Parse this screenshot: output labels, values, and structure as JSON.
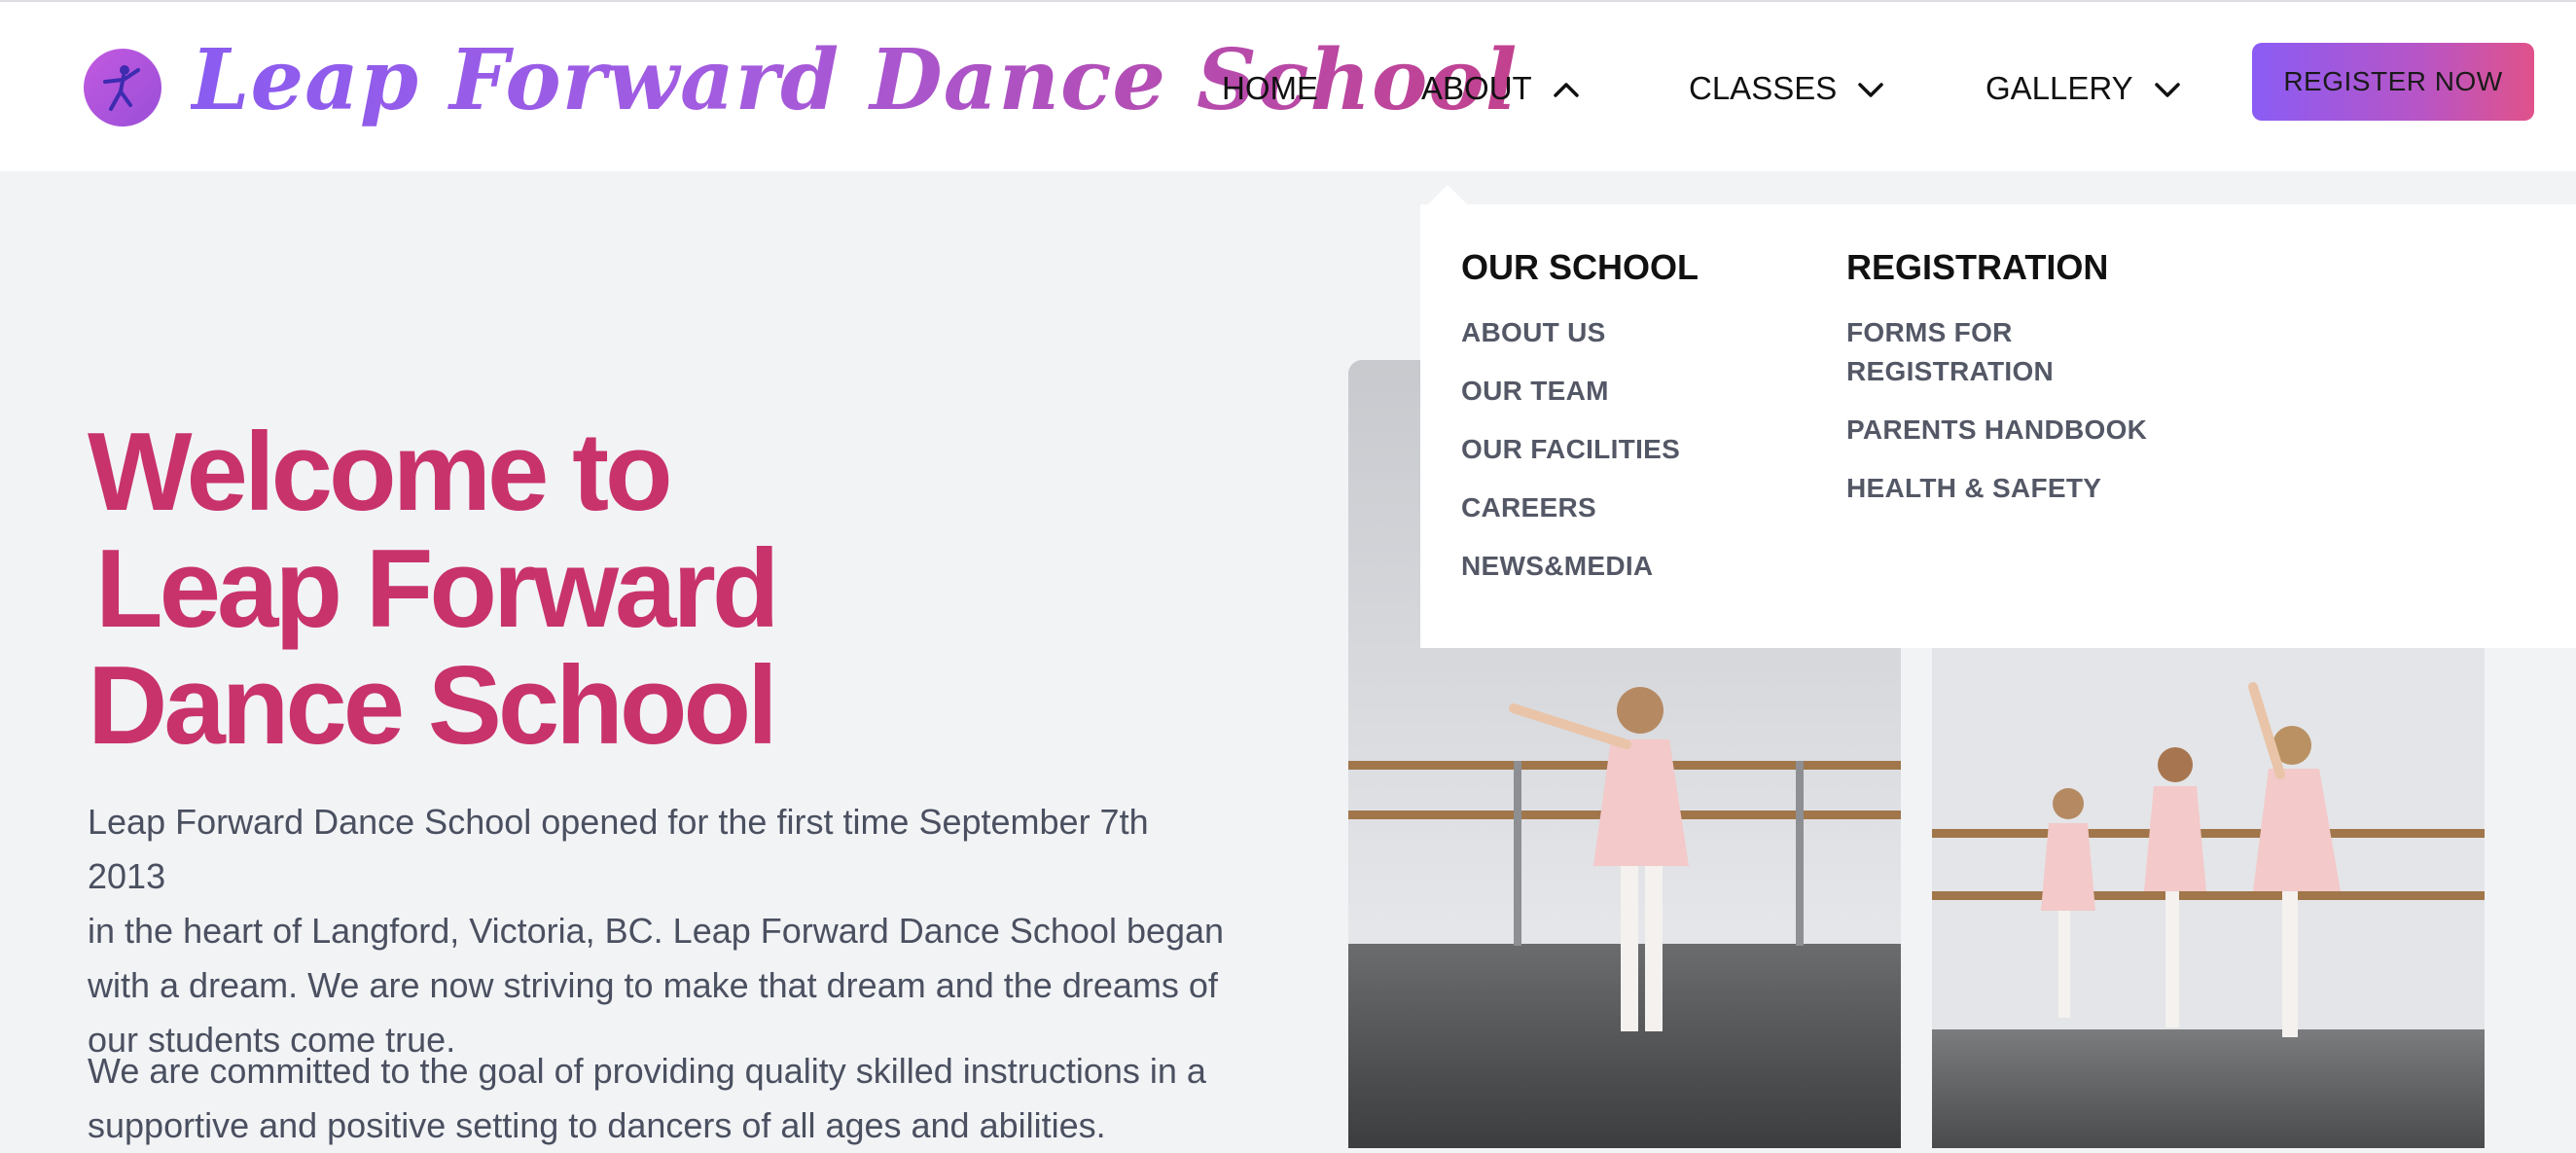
{
  "header": {
    "site_title": "Leap Forward Dance School",
    "nav": [
      {
        "label": "HOME"
      },
      {
        "label": "ABOUT",
        "chevron": "chevron-up-icon"
      },
      {
        "label": "CLASSES",
        "chevron": "chevron-down-icon"
      },
      {
        "label": "GALLERY",
        "chevron": "chevron-down-icon"
      }
    ],
    "register_label": "REGISTER NOW"
  },
  "dropdown": {
    "columns": [
      {
        "heading": "OUR SCHOOL",
        "links": [
          "ABOUT US",
          "OUR TEAM",
          "OUR FACILITIES",
          "CAREERS",
          "NEWS&MEDIA"
        ]
      },
      {
        "heading": "REGISTRATION",
        "links": [
          "FORMS FOR",
          "REGISTRATION",
          "PARENTS HANDBOOK",
          "HEALTH & SAFETY"
        ]
      }
    ]
  },
  "hero": {
    "title_lines": [
      "Welcome to",
      "Leap Forward",
      "Dance School"
    ],
    "paragraphs": [
      [
        "Leap Forward Dance School opened for the first time September 7th 2013",
        "in the heart of Langford, Victoria, BC. Leap Forward Dance School began",
        "with a dream. We are now striving to make that dream and the dreams of",
        "our students come true."
      ],
      [
        "We are committed to the goal of providing quality skilled instructions in a",
        "supportive and positive setting to dancers of all ages and abilities."
      ]
    ]
  },
  "colors": {
    "accent_pink": "#c8336c",
    "accent_purple": "#8a5cf0",
    "page_bg": "#f2f3f5"
  }
}
